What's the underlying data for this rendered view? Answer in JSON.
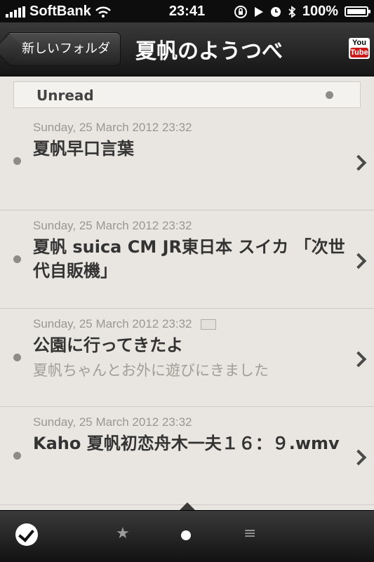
{
  "status_bar": {
    "carrier": "SoftBank",
    "time": "23:41",
    "battery": "100%"
  },
  "nav": {
    "back_label": "新しいフォルダ",
    "title": "夏帆のようつべ",
    "yt_you": "You",
    "yt_tube": "Tube"
  },
  "section": {
    "label": "Unread"
  },
  "items": [
    {
      "date": "Sunday, 25 March 2012 23:32",
      "title": "夏帆早口言葉",
      "summary": ""
    },
    {
      "date": "Sunday, 25 March 2012 23:32",
      "title": "夏帆 suica CM JR東日本 スイカ 「次世代自販機」",
      "summary": ""
    },
    {
      "date": "Sunday, 25 March 2012 23:32",
      "title": "公園に行ってきたよ",
      "summary": "夏帆ちゃんとお外に遊びにきました"
    },
    {
      "date": "Sunday, 25 March 2012 23:32",
      "title": "Kaho 夏帆初恋舟木一夫１６：９.wmv",
      "summary": ""
    }
  ],
  "toolbar": {
    "star": "★",
    "list": "≡"
  }
}
